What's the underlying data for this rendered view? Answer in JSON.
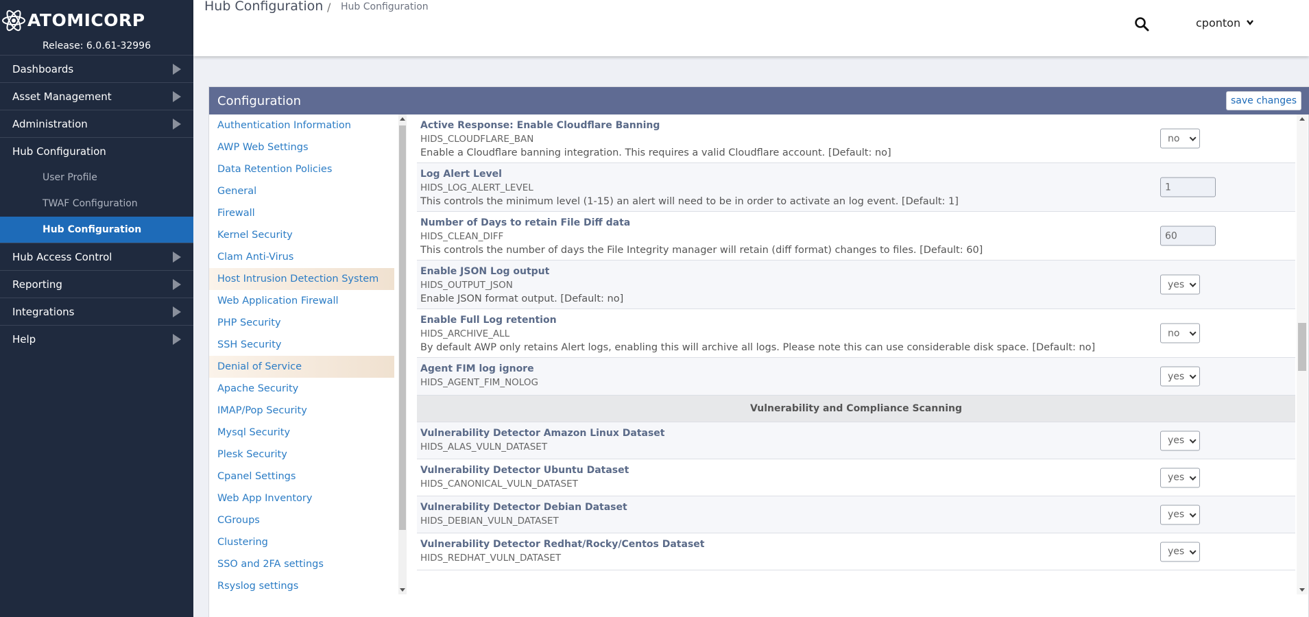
{
  "brand": {
    "name": "ATOMICORP",
    "release": "Release: 6.0.61-32996"
  },
  "sidebar": {
    "items": [
      {
        "label": "Dashboards",
        "arrow": true
      },
      {
        "label": "Asset Management",
        "arrow": true
      },
      {
        "label": "Administration",
        "arrow": true
      },
      {
        "label": "Hub Configuration",
        "arrow": false
      },
      {
        "label": "User Profile",
        "sub": true
      },
      {
        "label": "TWAF Configuration",
        "sub": true
      },
      {
        "label": "Hub Configuration",
        "sub": true,
        "active": true
      },
      {
        "label": "Hub Access Control",
        "arrow": true
      },
      {
        "label": "Reporting",
        "arrow": true
      },
      {
        "label": "Integrations",
        "arrow": true
      },
      {
        "label": "Help",
        "arrow": true
      }
    ]
  },
  "header": {
    "title": "Hub Configuration",
    "separator": "/",
    "current": "Hub Configuration",
    "user": "cponton"
  },
  "panel": {
    "title": "Configuration",
    "save_label": "save changes"
  },
  "config_menu": [
    "Authentication Information",
    "AWP Web Settings",
    "Data Retention Policies",
    "General",
    "Firewall",
    "Kernel Security",
    "Clam Anti-Virus",
    "Host Intrusion Detection System",
    "Web Application Firewall",
    "PHP Security",
    "SSH Security",
    "Denial of Service",
    "Apache Security",
    "IMAP/Pop Security",
    "Mysql Security",
    "Plesk Security",
    "Cpanel Settings",
    "Web App Inventory",
    "CGroups",
    "Clustering",
    "SSO and 2FA settings",
    "Rsyslog settings"
  ],
  "settings": [
    {
      "title": "Active Response: Enable Cloudflare Banning",
      "key": "HIDS_CLOUDFLARE_BAN",
      "desc": "Enable a Cloudflare banning integration. This requires a valid Cloudflare account. [Default: no]",
      "control": "select",
      "value": "no"
    },
    {
      "title": "Log Alert Level",
      "key": "HIDS_LOG_ALERT_LEVEL",
      "desc": "This controls the minimum level (1-15) an alert will need to be in order to activate an log event. [Default: 1]",
      "control": "text",
      "value": "1"
    },
    {
      "title": "Number of Days to retain File Diff data",
      "key": "HIDS_CLEAN_DIFF",
      "desc": "This controls the number of days the File Integrity manager will retain (diff format) changes to files. [Default: 60]",
      "control": "text",
      "value": "60"
    },
    {
      "title": "Enable JSON Log output",
      "key": "HIDS_OUTPUT_JSON",
      "desc": "Enable JSON format output. [Default: no]",
      "control": "select",
      "value": "yes"
    },
    {
      "title": "Enable Full Log retention",
      "key": "HIDS_ARCHIVE_ALL",
      "desc": "By default AWP only retains Alert logs, enabling this will archive all logs. Please note this can use considerable disk space. [Default: no]",
      "control": "select",
      "value": "no"
    },
    {
      "title": "Agent FIM log ignore",
      "key": "HIDS_AGENT_FIM_NOLOG",
      "desc": "",
      "control": "select",
      "value": "yes"
    }
  ],
  "section": "Vulnerability and Compliance Scanning",
  "vuln_settings": [
    {
      "title": "Vulnerability Detector Amazon Linux Dataset",
      "key": "HIDS_ALAS_VULN_DATASET",
      "control": "select",
      "value": "yes"
    },
    {
      "title": "Vulnerability Detector Ubuntu Dataset",
      "key": "HIDS_CANONICAL_VULN_DATASET",
      "control": "select",
      "value": "yes"
    },
    {
      "title": "Vulnerability Detector Debian Dataset",
      "key": "HIDS_DEBIAN_VULN_DATASET",
      "control": "select",
      "value": "yes"
    },
    {
      "title": "Vulnerability Detector Redhat/Rocky/Centos Dataset",
      "key": "HIDS_REDHAT_VULN_DATASET",
      "control": "select",
      "value": "yes"
    }
  ],
  "icons": {
    "logo": "atom-icon",
    "search": "search-icon",
    "user": "chevron-down-icon",
    "nav": "triangle-right-icon"
  },
  "colors": {
    "sidebar": "#1f2a3e",
    "active": "#1e6bb8",
    "panel_header": "#5f6b93",
    "link": "#2b7cc5"
  }
}
